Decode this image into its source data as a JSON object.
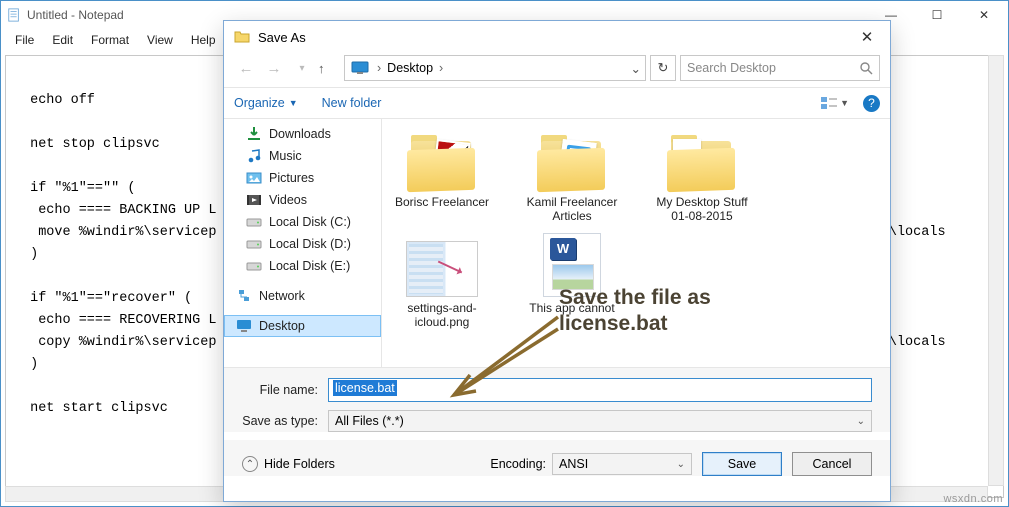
{
  "notepad": {
    "title": "Untitled - Notepad",
    "menu": [
      "File",
      "Edit",
      "Format",
      "View",
      "Help"
    ],
    "content": "\n echo off\n\n net stop clipsvc\n\n if \"%1\"==\"\" (\n  echo ==== BACKING UP L\n  move %windir%\\servicep                                                                              files\\locals\n )\n\n if \"%1\"==\"recover\" (\n  echo ==== RECOVERING L\n  copy %windir%\\servicep                                                                              files\\locals\n )\n\n net start clipsvc\n"
  },
  "saveas": {
    "title": "Save As",
    "breadcrumb_root": "Desktop",
    "search_placeholder": "Search Desktop",
    "organize": "Organize",
    "newfolder": "New folder",
    "sidebar": [
      {
        "icon": "download",
        "label": "Downloads"
      },
      {
        "icon": "music",
        "label": "Music"
      },
      {
        "icon": "pictures",
        "label": "Pictures"
      },
      {
        "icon": "videos",
        "label": "Videos"
      },
      {
        "icon": "disk",
        "label": "Local Disk (C:)"
      },
      {
        "icon": "disk",
        "label": "Local Disk (D:)"
      },
      {
        "icon": "disk",
        "label": "Local Disk (E:)"
      },
      {
        "icon": "network",
        "label": "Network"
      },
      {
        "icon": "desktop",
        "label": "Desktop",
        "selected": true
      }
    ],
    "files": [
      {
        "type": "folder-pic-b",
        "label": "Borisc Freelancer"
      },
      {
        "type": "folder-pic-k",
        "label": "Kamil Freelancer Articles"
      },
      {
        "type": "folder-pap",
        "label": "My Desktop Stuff 01-08-2015"
      },
      {
        "type": "image",
        "label": "settings-and-icloud.png"
      },
      {
        "type": "word",
        "label": "This app cannot"
      }
    ],
    "filename_label": "File name:",
    "filename_value": "license.bat",
    "saveastype_label": "Save as type:",
    "saveastype_value": "All Files  (*.*)",
    "hide_folders": "Hide Folders",
    "encoding_label": "Encoding:",
    "encoding_value": "ANSI",
    "save_btn": "Save",
    "cancel_btn": "Cancel"
  },
  "annotation": "Save the file as\nlicense.bat",
  "watermark": "wsxdn.com"
}
